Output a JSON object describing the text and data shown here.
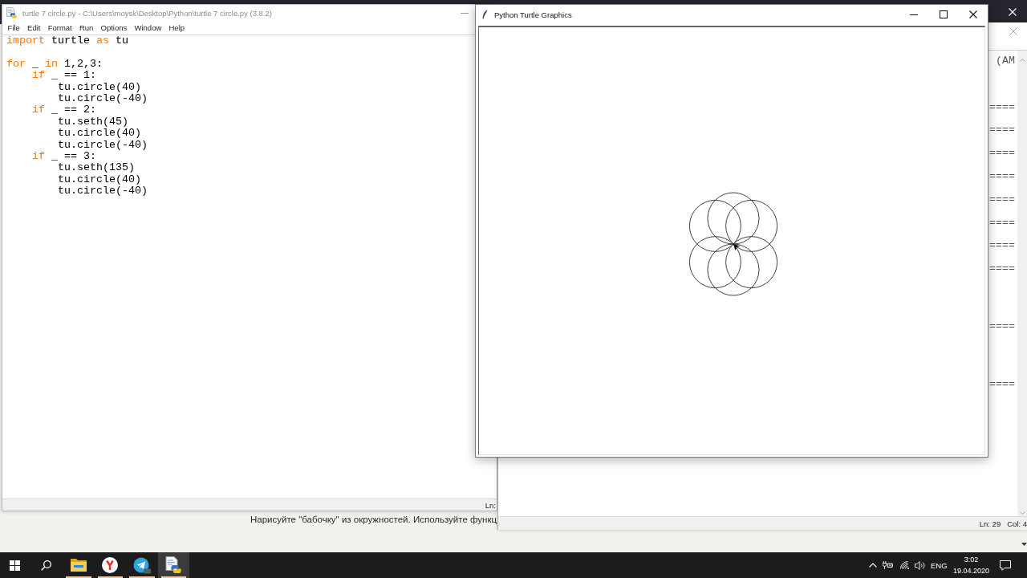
{
  "browser": {
    "page_text": "Нарисуйте \"бабочку\" из окружностей. Используйте функц"
  },
  "editor": {
    "title": "turtle 7 circle.py - C:\\Users\\moysk\\Desktop\\Python\\turtle 7 circle.py (3.8.2)",
    "active": false,
    "menu": [
      "File",
      "Edit",
      "Format",
      "Run",
      "Options",
      "Window",
      "Help"
    ],
    "code": [
      {
        "lines": [
          {
            "tokens": [
              {
                "kind": "keyword",
                "text": "import"
              },
              {
                "kind": "plain",
                "text": " turtle "
              },
              {
                "kind": "keyword",
                "text": "as"
              },
              {
                "kind": "plain",
                "text": " tu"
              }
            ]
          }
        ]
      },
      {
        "lines": [
          {
            "tokens": [
              {
                "kind": "keyword",
                "text": "for"
              },
              {
                "kind": "plain",
                "text": " _ "
              },
              {
                "kind": "keyword",
                "text": "in"
              },
              {
                "kind": "plain",
                "text": " 1,2,3:"
              }
            ],
            "children": [
              {
                "tokens": [
                  {
                    "kind": "keyword",
                    "text": "if"
                  },
                  {
                    "kind": "plain",
                    "text": " _ == 1:"
                  }
                ],
                "children": [
                  {
                    "tokens": [
                      {
                        "kind": "plain",
                        "text": "tu.circle(40)"
                      }
                    ]
                  },
                  {
                    "tokens": [
                      {
                        "kind": "plain",
                        "text": "tu.circle(-40)"
                      }
                    ]
                  }
                ]
              },
              {
                "tokens": [
                  {
                    "kind": "keyword",
                    "text": "if"
                  },
                  {
                    "kind": "plain",
                    "text": " _ == 2:"
                  }
                ],
                "children": [
                  {
                    "tokens": [
                      {
                        "kind": "plain",
                        "text": "tu.seth(45)"
                      }
                    ]
                  },
                  {
                    "tokens": [
                      {
                        "kind": "plain",
                        "text": "tu.circle(40)"
                      }
                    ]
                  },
                  {
                    "tokens": [
                      {
                        "kind": "plain",
                        "text": "tu.circle(-40)"
                      }
                    ]
                  }
                ]
              },
              {
                "tokens": [
                  {
                    "kind": "keyword",
                    "text": "if"
                  },
                  {
                    "kind": "plain",
                    "text": " _ == 3:"
                  }
                ],
                "children": [
                  {
                    "tokens": [
                      {
                        "kind": "plain",
                        "text": "tu.seth(135)"
                      }
                    ]
                  },
                  {
                    "tokens": [
                      {
                        "kind": "plain",
                        "text": "tu.circle(40)"
                      }
                    ]
                  },
                  {
                    "tokens": [
                      {
                        "kind": "plain",
                        "text": "tu.circle(-40)"
                      }
                    ]
                  }
                ]
              }
            ]
          }
        ]
      }
    ],
    "status": "Ln:"
  },
  "shell": {
    "active": false,
    "lines": [
      "(AM",
      "====",
      "====",
      "====",
      "====",
      "====",
      "====",
      "====",
      "====",
      "====",
      "===="
    ],
    "status": [
      "Ln: 29",
      "Col: 4"
    ]
  },
  "turtle_window": {
    "title": "Python Turtle Graphics",
    "active": true
  },
  "taskbar": {
    "apps": [
      {
        "kind": "folder",
        "open": true,
        "selected": false
      },
      {
        "kind": "y-browser",
        "open": true,
        "selected": false
      },
      {
        "kind": "messenger",
        "open": true,
        "selected": false
      },
      {
        "kind": "python",
        "open": true,
        "selected": true
      }
    ],
    "tray": {
      "language": "ENG",
      "time": "3:02",
      "date": "19.04.2020"
    }
  }
}
